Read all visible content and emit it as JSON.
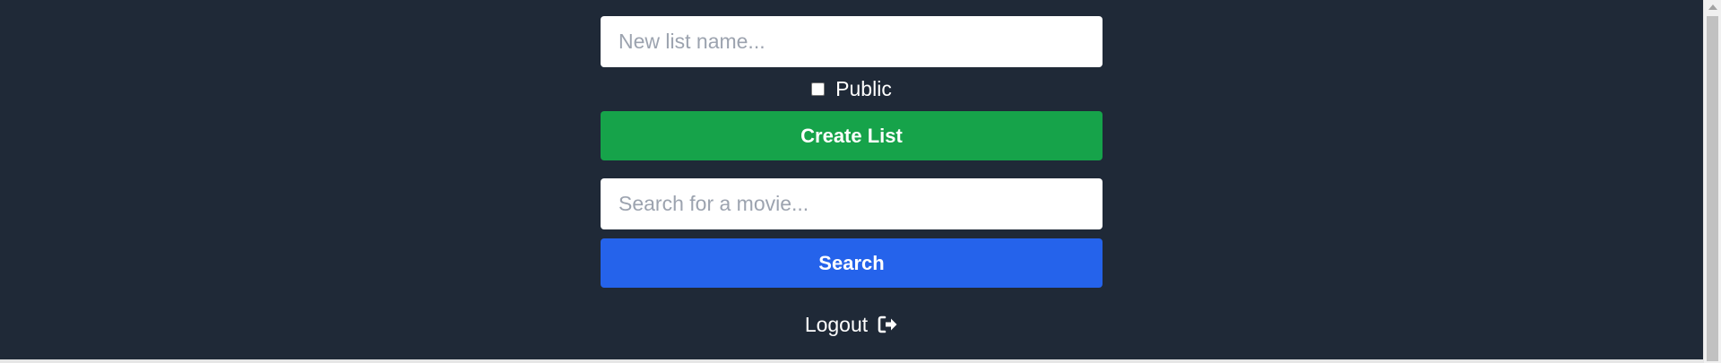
{
  "create_list": {
    "name_placeholder": "New list name...",
    "public_label": "Public",
    "public_checked": false,
    "create_button_label": "Create List"
  },
  "movie_search": {
    "placeholder": "Search for a movie...",
    "search_button_label": "Search"
  },
  "logout": {
    "label": "Logout",
    "icon": "logout-icon"
  },
  "colors": {
    "background": "#1f2937",
    "create_button": "#16a34a",
    "search_button": "#2563eb"
  }
}
